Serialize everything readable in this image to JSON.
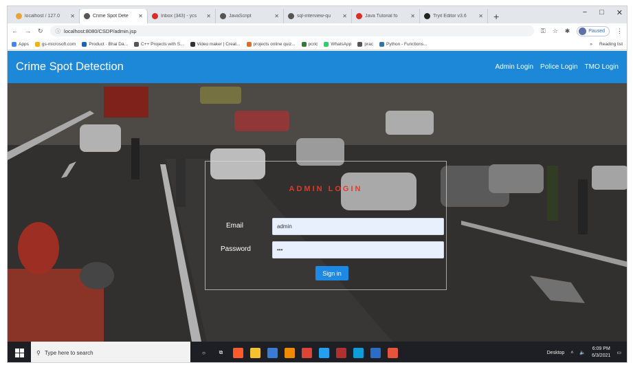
{
  "browser": {
    "tabs": [
      {
        "title": "localhost / 127.0",
        "color": "#e8a33b",
        "active": false
      },
      {
        "title": "Crime Spot Dete",
        "color": "#555555",
        "active": true
      },
      {
        "title": "Inbox (343) - ycs",
        "color": "#d93025",
        "active": false
      },
      {
        "title": "JavaScript",
        "color": "#555555",
        "active": false
      },
      {
        "title": "sql-interview-qu",
        "color": "#555555",
        "active": false
      },
      {
        "title": "Java Tutorial fo",
        "color": "#d93025",
        "active": false
      },
      {
        "title": "Tryit Editor v3.6",
        "color": "#222222",
        "active": false
      }
    ],
    "new_tab": "+",
    "window_controls": {
      "minimize": "−",
      "maximize": "□",
      "close": "✕"
    },
    "url": "localhost:8080/CSDP/admin.jsp",
    "profile_label": "Paused",
    "bookmarks": [
      {
        "label": "Apps",
        "color": "#4285f4"
      },
      {
        "label": "gs-microsoft.com",
        "color": "#f4b400"
      },
      {
        "label": "Product · Bhai Da...",
        "color": "#1565c0"
      },
      {
        "label": "C++ Projects with S...",
        "color": "#555555"
      },
      {
        "label": "Video maker | Creat...",
        "color": "#333333"
      },
      {
        "label": "projects online quiz...",
        "color": "#e06c1f"
      },
      {
        "label": "pcric",
        "color": "#2e7d32"
      },
      {
        "label": "WhatsApp",
        "color": "#25d366"
      },
      {
        "label": "prac",
        "color": "#555555"
      },
      {
        "label": "Python - Functions...",
        "color": "#3572a5"
      }
    ],
    "bookmarks_right": [
      "»",
      "Reading list"
    ]
  },
  "navbar": {
    "brand": "Crime Spot Detection",
    "links": [
      "Admin Login",
      "Police Login",
      "TMO Login"
    ]
  },
  "login": {
    "title": "ADMIN LOGIN",
    "email_label": "Email",
    "email_value": "admin",
    "password_label": "Password",
    "password_value": "•••",
    "submit": "Sign in"
  },
  "taskbar": {
    "search_placeholder": "Type here to search",
    "apps": [
      {
        "name": "cortana-icon",
        "glyph": "○",
        "color": "#1e1f24"
      },
      {
        "name": "task-view-icon",
        "glyph": "⧉",
        "color": "#1e1f24"
      },
      {
        "name": "brave-icon",
        "glyph": "",
        "color": "#ff5a2c"
      },
      {
        "name": "file-explorer-icon",
        "glyph": "",
        "color": "#f2c230"
      },
      {
        "name": "store-icon",
        "glyph": "",
        "color": "#3a7bd5"
      },
      {
        "name": "vlc-icon",
        "glyph": "",
        "color": "#f08a00"
      },
      {
        "name": "chrome-icon",
        "glyph": "",
        "color": "#db4437"
      },
      {
        "name": "vscode-icon",
        "glyph": "",
        "color": "#23a0f0"
      },
      {
        "name": "app-icon",
        "glyph": "",
        "color": "#b03030"
      },
      {
        "name": "edge-icon",
        "glyph": "",
        "color": "#0f9dd8"
      },
      {
        "name": "word-icon",
        "glyph": "",
        "color": "#2b6cc7"
      },
      {
        "name": "app2-icon",
        "glyph": "",
        "color": "#e5553b"
      }
    ],
    "tray_label": "Desktop",
    "time": "6:09 PM",
    "date": "6/3/2021"
  }
}
